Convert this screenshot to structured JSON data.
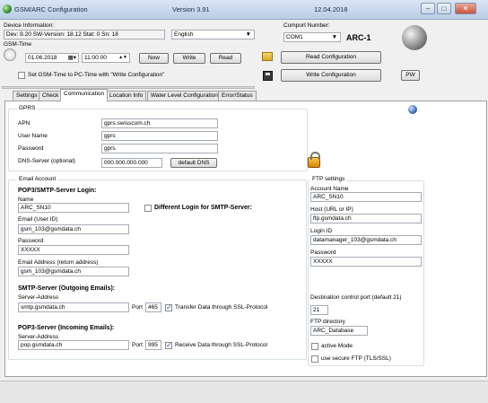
{
  "window": {
    "title": "GSM/ARC Configuration",
    "version": "Version 3.91",
    "date": "12.04.2018"
  },
  "device": {
    "label": "Device Information:",
    "info": "Dev: 9.20 SW-Version: 18.12 Stat: 0  Sn: 18",
    "language": "English",
    "gsm_time_label": "GSM-Time",
    "date": "01.06.2018",
    "time": "11:00:00",
    "now_button": "Now",
    "write_button": "Write",
    "read_button": "Read",
    "set_time_label": "Set GSM-Time to PC-Time with \"Write Configuration\""
  },
  "comport": {
    "label": "Comport Number:",
    "value": "COM1",
    "device": "ARC-1"
  },
  "actions": {
    "read_config": "Read Configuration",
    "write_config": "Write Configuration",
    "pw": "PW"
  },
  "tabs": [
    "Settings",
    "Check",
    "Communication",
    "Location Info",
    "Water Level Configuration",
    "Error/Status"
  ],
  "gprs": {
    "title": "GPRS",
    "apn_label": "APN",
    "apn": "gprs.swisscom.ch",
    "user_label": "User Name",
    "user": "gprs",
    "pass_label": "Password",
    "pass": "gprs",
    "dns_label": "DNS-Server (optional)",
    "dns": "000.000.000.000",
    "dns_button": "default DNS"
  },
  "email": {
    "title": "Email Account",
    "pop_header": "POP3/SMTP-Server Login:",
    "name_label": "Name",
    "name": "ARC_SN10",
    "diff_login": "Different Login for SMTP-Server:",
    "user_label": "Email (User ID)",
    "user": "gsm_103@gsmdata.ch",
    "pass_label": "Password",
    "pass": "XXXXX",
    "ret_label": "Email Address (return address)",
    "ret": "gsm_103@gsmdata.ch",
    "smtp_header": "SMTP-Server (Outgoing Emails):",
    "smtp_addr_label": "Server-Address",
    "smtp_addr": "smtp.gsmdata.ch",
    "port_label": "Port",
    "smtp_port": "465",
    "smtp_ssl": "Transfer Data through SSL-Protocol",
    "pop3_header": "POP3-Server (Incoming Emails):",
    "pop3_addr_label": "Server-Address",
    "pop3_addr": "pop.gsmdata.ch",
    "pop3_port": "995",
    "pop3_ssl": "Receive Data through SSL-Protocol"
  },
  "ftp": {
    "title": "FTP settings",
    "account_label": "Account Name",
    "account": "ARC_SN10",
    "host_label": "Host (URL or IP)",
    "host": "ftp.gsmdata.ch",
    "login_label": "Login ID",
    "login": "datamanager_103@gsmdata.ch",
    "pass_label": "Password",
    "pass": "XXXXX",
    "dest_port_label": "Destination control port (default 21)",
    "dest_port": "21",
    "dir_label": "FTP directory",
    "dir": "ARC_Database",
    "active_mode": "active Mode",
    "secure": "use secure FTP (TLS/SSL)"
  }
}
